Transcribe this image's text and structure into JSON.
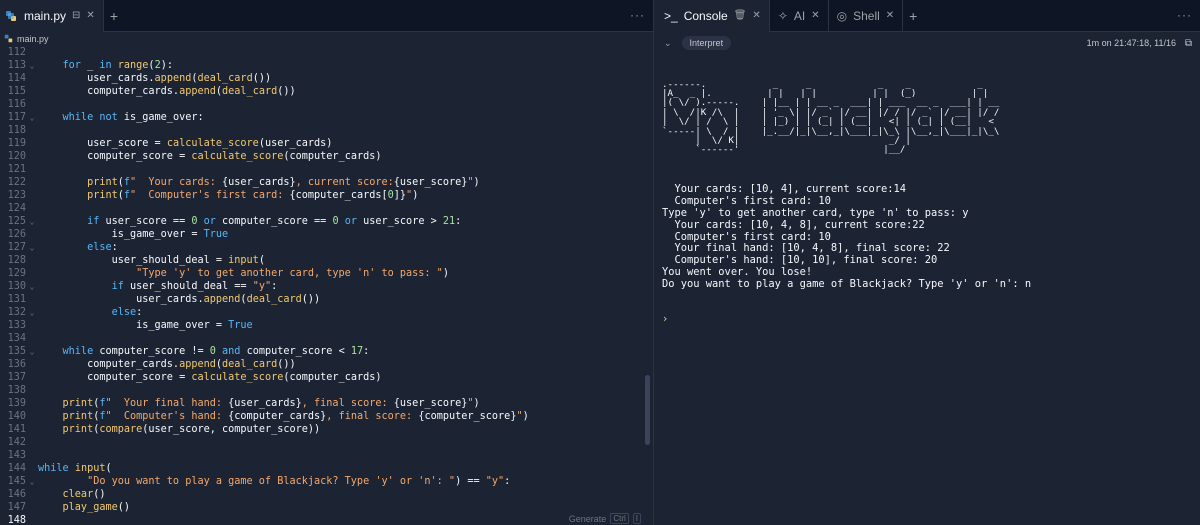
{
  "editor": {
    "tab_label": "main.py",
    "breadcrumb": "main.py",
    "menu_dots": "···",
    "generate_hint": "Generate",
    "shortcut": "Ctrl",
    "shortcut_key": "I",
    "lines": [
      {
        "n": "112",
        "fold": "",
        "tokens": []
      },
      {
        "n": "113",
        "fold": "⌄",
        "tokens": [
          [
            "kw",
            "    for"
          ],
          [
            "var",
            " _ "
          ],
          [
            "kw",
            "in "
          ],
          [
            "fn",
            "range"
          ],
          [
            "var",
            "("
          ],
          [
            "num",
            "2"
          ],
          [
            "var",
            "):"
          ]
        ]
      },
      {
        "n": "114",
        "fold": "",
        "tokens": [
          [
            "var",
            "        user_cards."
          ],
          [
            "fn",
            "append"
          ],
          [
            "var",
            "("
          ],
          [
            "fn",
            "deal_card"
          ],
          [
            "var",
            "())"
          ]
        ]
      },
      {
        "n": "115",
        "fold": "",
        "tokens": [
          [
            "var",
            "        computer_cards."
          ],
          [
            "fn",
            "append"
          ],
          [
            "var",
            "("
          ],
          [
            "fn",
            "deal_card"
          ],
          [
            "var",
            "())"
          ]
        ]
      },
      {
        "n": "116",
        "fold": "",
        "tokens": []
      },
      {
        "n": "117",
        "fold": "⌄",
        "tokens": [
          [
            "kw",
            "    while not "
          ],
          [
            "var",
            "is_game_over:"
          ]
        ]
      },
      {
        "n": "118",
        "fold": "",
        "tokens": []
      },
      {
        "n": "119",
        "fold": "",
        "tokens": [
          [
            "var",
            "        user_score = "
          ],
          [
            "fn",
            "calculate_score"
          ],
          [
            "var",
            "(user_cards)"
          ]
        ]
      },
      {
        "n": "120",
        "fold": "",
        "tokens": [
          [
            "var",
            "        computer_score = "
          ],
          [
            "fn",
            "calculate_score"
          ],
          [
            "var",
            "(computer_cards)"
          ]
        ]
      },
      {
        "n": "121",
        "fold": "",
        "tokens": []
      },
      {
        "n": "122",
        "fold": "",
        "tokens": [
          [
            "fn",
            "        print"
          ],
          [
            "var",
            "("
          ],
          [
            "kw",
            "f"
          ],
          [
            "str",
            "\"  Your cards: "
          ],
          [
            "var",
            "{user_cards}"
          ],
          [
            "str",
            ", current score:"
          ],
          [
            "var",
            "{user_score}"
          ],
          [
            "str",
            "\""
          ],
          [
            "var",
            ")"
          ]
        ]
      },
      {
        "n": "123",
        "fold": "",
        "tokens": [
          [
            "fn",
            "        print"
          ],
          [
            "var",
            "("
          ],
          [
            "kw",
            "f"
          ],
          [
            "str",
            "\"  Computer's first card: "
          ],
          [
            "var",
            "{computer_cards["
          ],
          [
            "num",
            "0"
          ],
          [
            "var",
            "]}"
          ],
          [
            "str",
            "\""
          ],
          [
            "var",
            ")"
          ]
        ]
      },
      {
        "n": "124",
        "fold": "",
        "tokens": []
      },
      {
        "n": "125",
        "fold": "⌄",
        "tokens": [
          [
            "kw",
            "        if "
          ],
          [
            "var",
            "user_score == "
          ],
          [
            "num",
            "0 "
          ],
          [
            "kw",
            "or "
          ],
          [
            "var",
            "computer_score == "
          ],
          [
            "num",
            "0 "
          ],
          [
            "kw",
            "or "
          ],
          [
            "var",
            "user_score > "
          ],
          [
            "num",
            "21"
          ],
          [
            "var",
            ":"
          ]
        ]
      },
      {
        "n": "126",
        "fold": "",
        "tokens": [
          [
            "var",
            "            is_game_over = "
          ],
          [
            "kw",
            "True"
          ]
        ]
      },
      {
        "n": "127",
        "fold": "⌄",
        "tokens": [
          [
            "kw",
            "        else"
          ],
          [
            "var",
            ":"
          ]
        ]
      },
      {
        "n": "128",
        "fold": "",
        "tokens": [
          [
            "var",
            "            user_should_deal = "
          ],
          [
            "fn",
            "input"
          ],
          [
            "var",
            "("
          ]
        ]
      },
      {
        "n": "129",
        "fold": "",
        "tokens": [
          [
            "str",
            "                \"Type 'y' to get another card, type 'n' to pass: \""
          ],
          [
            "var",
            ")"
          ]
        ]
      },
      {
        "n": "130",
        "fold": "⌄",
        "tokens": [
          [
            "kw",
            "            if "
          ],
          [
            "var",
            "user_should_deal == "
          ],
          [
            "str",
            "\"y\""
          ],
          [
            "var",
            ":"
          ]
        ]
      },
      {
        "n": "131",
        "fold": "",
        "tokens": [
          [
            "var",
            "                user_cards."
          ],
          [
            "fn",
            "append"
          ],
          [
            "var",
            "("
          ],
          [
            "fn",
            "deal_card"
          ],
          [
            "var",
            "())"
          ]
        ]
      },
      {
        "n": "132",
        "fold": "⌄",
        "tokens": [
          [
            "kw",
            "            else"
          ],
          [
            "var",
            ":"
          ]
        ]
      },
      {
        "n": "133",
        "fold": "",
        "tokens": [
          [
            "var",
            "                is_game_over = "
          ],
          [
            "kw",
            "True"
          ]
        ]
      },
      {
        "n": "134",
        "fold": "",
        "tokens": []
      },
      {
        "n": "135",
        "fold": "⌄",
        "tokens": [
          [
            "kw",
            "    while "
          ],
          [
            "var",
            "computer_score != "
          ],
          [
            "num",
            "0 "
          ],
          [
            "kw",
            "and "
          ],
          [
            "var",
            "computer_score < "
          ],
          [
            "num",
            "17"
          ],
          [
            "var",
            ":"
          ]
        ]
      },
      {
        "n": "136",
        "fold": "",
        "tokens": [
          [
            "var",
            "        computer_cards."
          ],
          [
            "fn",
            "append"
          ],
          [
            "var",
            "("
          ],
          [
            "fn",
            "deal_card"
          ],
          [
            "var",
            "())"
          ]
        ]
      },
      {
        "n": "137",
        "fold": "",
        "tokens": [
          [
            "var",
            "        computer_score = "
          ],
          [
            "fn",
            "calculate_score"
          ],
          [
            "var",
            "(computer_cards)"
          ]
        ]
      },
      {
        "n": "138",
        "fold": "",
        "tokens": []
      },
      {
        "n": "139",
        "fold": "",
        "tokens": [
          [
            "fn",
            "    print"
          ],
          [
            "var",
            "("
          ],
          [
            "kw",
            "f"
          ],
          [
            "str",
            "\"  Your final hand: "
          ],
          [
            "var",
            "{user_cards}"
          ],
          [
            "str",
            ", final score: "
          ],
          [
            "var",
            "{user_score}"
          ],
          [
            "str",
            "\""
          ],
          [
            "var",
            ")"
          ]
        ]
      },
      {
        "n": "140",
        "fold": "",
        "tokens": [
          [
            "fn",
            "    print"
          ],
          [
            "var",
            "("
          ],
          [
            "kw",
            "f"
          ],
          [
            "str",
            "\"  Computer's hand: "
          ],
          [
            "var",
            "{computer_cards}"
          ],
          [
            "str",
            ", final score: "
          ],
          [
            "var",
            "{computer_score}"
          ],
          [
            "str",
            "\""
          ],
          [
            "var",
            ")"
          ]
        ]
      },
      {
        "n": "141",
        "fold": "",
        "tokens": [
          [
            "fn",
            "    print"
          ],
          [
            "var",
            "("
          ],
          [
            "fn",
            "compare"
          ],
          [
            "var",
            "(user_score, computer_score))"
          ]
        ]
      },
      {
        "n": "142",
        "fold": "",
        "tokens": []
      },
      {
        "n": "143",
        "fold": "",
        "tokens": []
      },
      {
        "n": "144",
        "fold": "",
        "tokens": [
          [
            "kw",
            "while "
          ],
          [
            "fn",
            "input"
          ],
          [
            "var",
            "("
          ]
        ]
      },
      {
        "n": "145",
        "fold": "⌄",
        "tokens": [
          [
            "str",
            "        \"Do you want to play a game of Blackjack? Type 'y' or 'n': \""
          ],
          [
            "var",
            ") == "
          ],
          [
            "str",
            "\"y\""
          ],
          [
            "var",
            ":"
          ]
        ]
      },
      {
        "n": "146",
        "fold": "",
        "tokens": [
          [
            "fn",
            "    clear"
          ],
          [
            "var",
            "()"
          ]
        ]
      },
      {
        "n": "147",
        "fold": "",
        "tokens": [
          [
            "fn",
            "    play_game"
          ],
          [
            "var",
            "()"
          ]
        ]
      },
      {
        "n": "148",
        "fold": "",
        "tokens": [],
        "active": true
      }
    ]
  },
  "console": {
    "tabs": [
      {
        "label": "Console",
        "icon": "terminal-icon",
        "active": true
      },
      {
        "label": "AI",
        "icon": "sparkle-icon",
        "active": false
      },
      {
        "label": "Shell",
        "icon": "shell-icon",
        "active": false
      }
    ],
    "badge": "Interpret",
    "timestamp": "1m on 21:47:18, 11/16",
    "ascii_art": ".------.            _     _            _    _            _    \n|A_  _ |.          | |   | |          | |  (_)          | |   \n|( \\/ ).-----.    | |__ | | __ _  ___| | ___  __ _  ___| | __\n| \\  /|K /\\  |    | '_ \\| |/ _` |/ __| |/ / |/ _` |/ __| |/ /\n|  \\/ | /  \\ |    | |_) | | (_| | (__|   <| | (_| | (__|   < \n`-----| \\  / |    |_.__/|_|\\__,_|\\___|_|\\_\\ |\\__,_|\\___|_|\\_\\\n      |  \\/ K|                           _/ |                \n      `------'                          |__/                 ",
    "output_lines": [
      "  Your cards: [10, 4], current score:14",
      "  Computer's first card: 10",
      "Type 'y' to get another card, type 'n' to pass: y",
      "  Your cards: [10, 4, 8], current score:22",
      "  Computer's first card: 10",
      "  Your final hand: [10, 4, 8], final score: 22",
      "  Computer's hand: [10, 10], final score: 20",
      "You went over. You lose!",
      "Do you want to play a game of Blackjack? Type 'y' or 'n': n"
    ],
    "prompt": "›"
  }
}
